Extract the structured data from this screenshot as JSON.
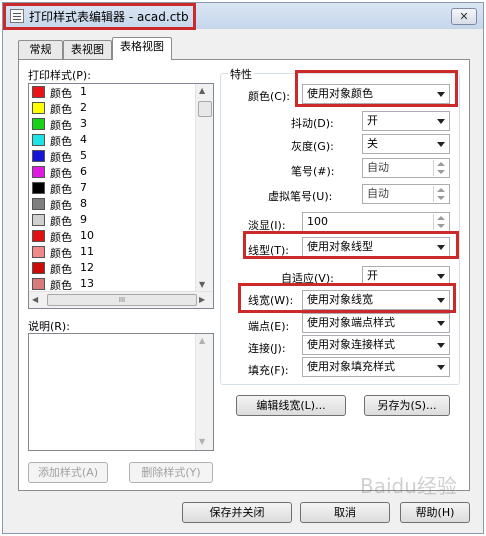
{
  "window": {
    "title": "打印样式表编辑器 - acad.ctb",
    "close_glyph": "✕"
  },
  "tabs": [
    {
      "label": "常规",
      "active": false
    },
    {
      "label": "表视图",
      "active": false
    },
    {
      "label": "表格视图",
      "active": true
    }
  ],
  "styles_panel": {
    "label": "打印样式(P):",
    "items": [
      {
        "name": "颜色",
        "num": "1",
        "color": "#e8141a"
      },
      {
        "name": "颜色",
        "num": "2",
        "color": "#ffff00"
      },
      {
        "name": "颜色",
        "num": "3",
        "color": "#17d317"
      },
      {
        "name": "颜色",
        "num": "4",
        "color": "#1ee3e3"
      },
      {
        "name": "颜色",
        "num": "5",
        "color": "#1515d8"
      },
      {
        "name": "颜色",
        "num": "6",
        "color": "#e01ae0"
      },
      {
        "name": "颜色",
        "num": "7",
        "color": "#000000"
      },
      {
        "name": "颜色",
        "num": "8",
        "color": "#7f7f7f"
      },
      {
        "name": "颜色",
        "num": "9",
        "color": "#d0d0d0"
      },
      {
        "name": "颜色",
        "num": "10",
        "color": "#e21111"
      },
      {
        "name": "颜色",
        "num": "11",
        "color": "#f08a8a"
      },
      {
        "name": "颜色",
        "num": "12",
        "color": "#cc0a0a"
      },
      {
        "name": "颜色",
        "num": "13",
        "color": "#d97b7b"
      }
    ],
    "hscroll_thumb": "III",
    "description_label": "说明(R):",
    "add_button": "添加样式(A)",
    "delete_button": "删除样式(Y)"
  },
  "properties": {
    "group_title": "特性",
    "color": {
      "label": "颜色(C):",
      "value": "使用对象颜色"
    },
    "dither": {
      "label": "抖动(D):",
      "value": "开"
    },
    "grayscale": {
      "label": "灰度(G):",
      "value": "关"
    },
    "pen_number": {
      "label": "笔号(#):",
      "value": "自动"
    },
    "virtual_pen": {
      "label": "虚拟笔号(U):",
      "value": "自动"
    },
    "screening": {
      "label": "淡显(I):",
      "value": "100"
    },
    "linetype": {
      "label": "线型(T):",
      "value": "使用对象线型"
    },
    "adaptive": {
      "label": "自适应(V):",
      "value": "开"
    },
    "lineweight": {
      "label": "线宽(W):",
      "value": "使用对象线宽"
    },
    "line_end": {
      "label": "端点(E):",
      "value": "使用对象端点样式"
    },
    "line_join": {
      "label": "连接(J):",
      "value": "使用对象连接样式"
    },
    "fill": {
      "label": "填充(F):",
      "value": "使用对象填充样式"
    },
    "edit_lineweights": "编辑线宽(L)...",
    "save_as": "另存为(S)..."
  },
  "footer": {
    "save_close": "保存并关闭",
    "cancel": "取消",
    "help": "帮助(H)"
  },
  "watermark": "Baidu经验"
}
